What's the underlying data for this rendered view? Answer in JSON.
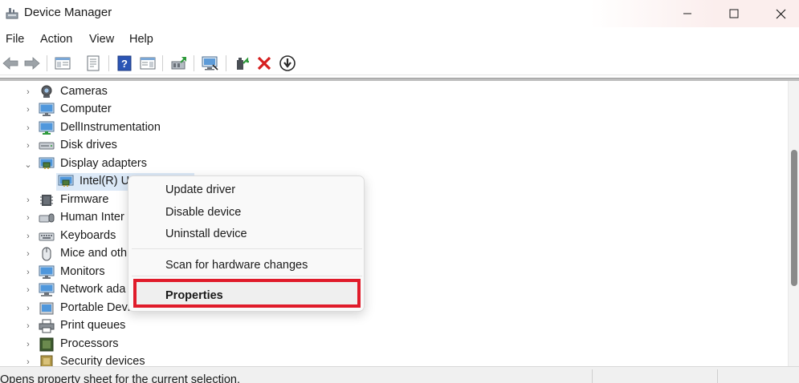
{
  "window": {
    "title": "Device Manager",
    "icon": "device-manager-icon",
    "controls": [
      "minimize-icon",
      "maximize-icon",
      "close-icon"
    ]
  },
  "menu": {
    "items": [
      "File",
      "Action",
      "View",
      "Help"
    ]
  },
  "toolbar": {
    "buttons": [
      "back-arrow-icon",
      "forward-arrow-icon",
      "show-hide-console-tree-icon",
      "properties-sheet-icon",
      "help-icon",
      "action-pane-icon",
      "update-driver-icon",
      "scan-hardware-icon",
      "enable-device-icon",
      "uninstall-device-icon",
      "disable-device-icon"
    ]
  },
  "tree": {
    "items": [
      {
        "label": "Cameras",
        "icon": "camera-icon",
        "expanded": false
      },
      {
        "label": "Computer",
        "icon": "computer-monitor-icon",
        "expanded": false
      },
      {
        "label": "DellInstrumentation",
        "icon": "computer-monitor-icon",
        "expanded": false
      },
      {
        "label": "Disk drives",
        "icon": "disk-drive-icon",
        "expanded": false
      },
      {
        "label": "Display adapters",
        "icon": "display-adapter-icon",
        "expanded": true
      },
      {
        "label": "Intel(R) U",
        "icon": "display-adapter-icon",
        "child": true,
        "selected": true
      },
      {
        "label": "Firmware",
        "icon": "firmware-icon",
        "expanded": false
      },
      {
        "label": "Human Inter",
        "icon": "hid-icon",
        "expanded": false
      },
      {
        "label": "Keyboards",
        "icon": "keyboard-icon",
        "expanded": false
      },
      {
        "label": "Mice and oth",
        "icon": "mouse-icon",
        "expanded": false
      },
      {
        "label": "Monitors",
        "icon": "monitor-icon",
        "expanded": false
      },
      {
        "label": "Network ada",
        "icon": "network-adapter-icon",
        "expanded": false
      },
      {
        "label": "Portable Devices",
        "icon": "portable-device-icon",
        "expanded": false
      },
      {
        "label": "Print queues",
        "icon": "printer-icon",
        "expanded": false
      },
      {
        "label": "Processors",
        "icon": "processor-icon",
        "expanded": false
      },
      {
        "label": "Security devices",
        "icon": "security-device-icon",
        "expanded": false
      }
    ]
  },
  "context_menu": {
    "items": [
      "Update driver",
      "Disable device",
      "Uninstall device",
      "Scan for hardware changes",
      "Properties"
    ],
    "highlighted": "Properties",
    "highlight_color": "#e01b2a"
  },
  "status": {
    "text": "Opens property sheet for the current selection."
  },
  "colors": {
    "selection": "#dce9f7",
    "highlight_box": "#e01b2a"
  }
}
